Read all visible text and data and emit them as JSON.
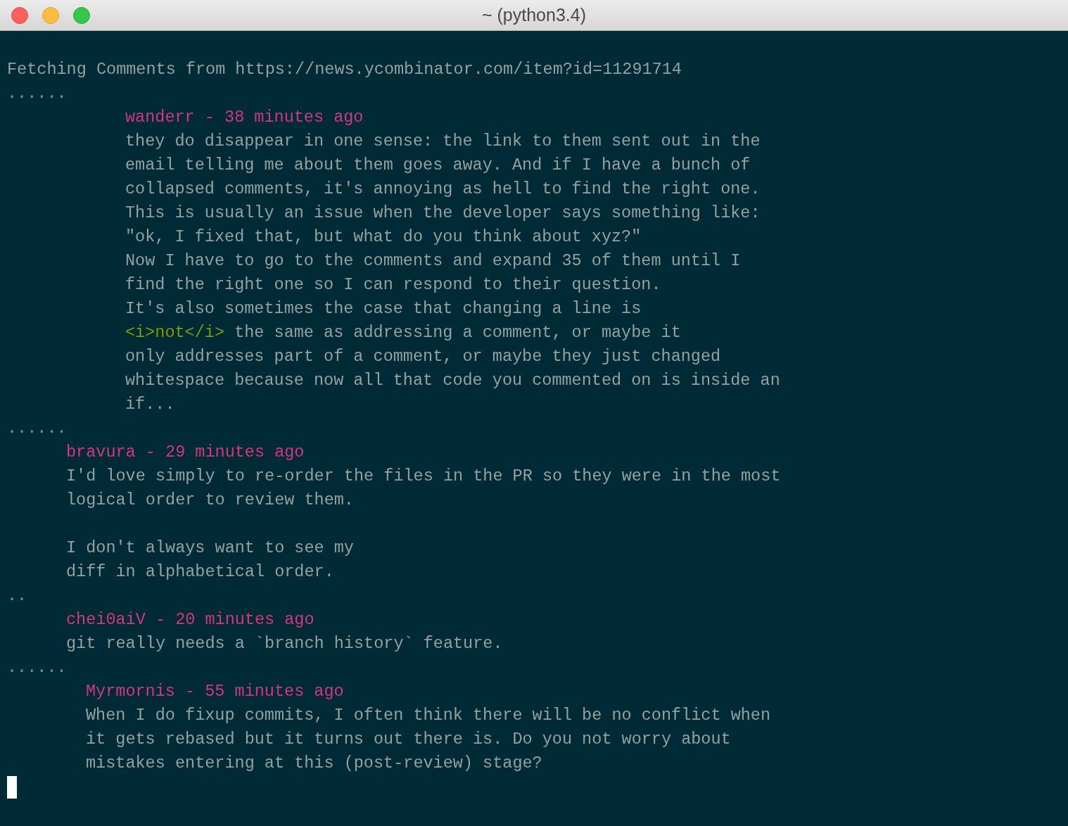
{
  "window": {
    "title": "~ (python3.4)"
  },
  "status_line": "Fetching Comments from https://news.ycombinator.com/item?id=11291714",
  "comments": [
    {
      "dots": "......",
      "kind": "deep",
      "header": "wanderr - 38 minutes ago",
      "lines": [
        {
          "kind": "plain",
          "text": "they do disappear in one sense: the link to them sent out in the"
        },
        {
          "kind": "plain",
          "text": "email telling me about them goes away. And if I have a bunch of"
        },
        {
          "kind": "plain",
          "text": "collapsed comments, it's annoying as hell to find the right one."
        },
        {
          "kind": "plain",
          "text": "This is usually an issue when the developer says something like:"
        },
        {
          "kind": "plain",
          "text": "\"ok, I fixed that, but what do you think about xyz?\""
        },
        {
          "kind": "plain",
          "text": "Now I have to go to the comments and expand 35 of them until I"
        },
        {
          "kind": "plain",
          "text": "find the right one so I can respond to their question."
        },
        {
          "kind": "plain",
          "text": "It's also sometimes the case that changing a line is"
        },
        {
          "kind": "markup",
          "markup": "<i>not</i>",
          "text": " the same as addressing a comment, or maybe it"
        },
        {
          "kind": "plain",
          "text": "only addresses part of a comment, or maybe they just changed"
        },
        {
          "kind": "plain",
          "text": "whitespace because now all that code you commented on is inside an"
        },
        {
          "kind": "plain",
          "text": "if..."
        }
      ]
    },
    {
      "dots": "......",
      "kind": "shallow",
      "header": "bravura - 29 minutes ago",
      "lines": [
        {
          "kind": "plain",
          "text": "I'd love simply to re-order the files in the PR so they were in the most"
        },
        {
          "kind": "plain",
          "text": "logical order to review them."
        },
        {
          "kind": "blank"
        },
        {
          "kind": "plain",
          "text": "I don't always want to see my"
        },
        {
          "kind": "plain",
          "text": "diff in alphabetical order."
        }
      ]
    },
    {
      "dots": "..",
      "kind": "shallow",
      "header": "chei0aiV - 20 minutes ago",
      "lines": [
        {
          "kind": "plain",
          "text": "git really needs a `branch history` feature."
        }
      ]
    },
    {
      "dots": "......",
      "kind": "middle",
      "header": "Myrmornis - 55 minutes ago",
      "lines": [
        {
          "kind": "plain",
          "text": "When I do fixup commits, I often think there will be no conflict when"
        },
        {
          "kind": "plain",
          "text": "it gets rebased but it turns out there is. Do you not worry about"
        },
        {
          "kind": "plain",
          "text": "mistakes entering at this (post-review) stage?"
        }
      ]
    }
  ]
}
